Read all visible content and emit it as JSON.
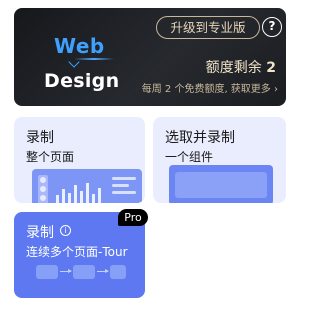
{
  "banner": {
    "logo_top": "Web",
    "logo_bottom": "Design",
    "upgrade_label": "升级到专业版",
    "help_label": "?",
    "quota_label": "额度剩余",
    "quota_value": "2",
    "quota_note": "每周 2 个免费额度, 获取更多 ›"
  },
  "cards": {
    "full_page": {
      "title": "录制",
      "subtitle": "整个页面"
    },
    "component": {
      "title": "选取并录制",
      "subtitle": "一个组件"
    },
    "tour": {
      "title": "录制",
      "subtitle": "连续多个页面-Tour",
      "badge": "Pro",
      "info_icon": "i"
    }
  },
  "colors": {
    "banner_bg": "#1f2125",
    "accent_blue": "#3ea0ff",
    "gold": "#e8d7b9",
    "card_bg": "#e9edfd",
    "tour_bg": "#5d78f0"
  },
  "icons": [
    "help-icon",
    "info-icon"
  ]
}
